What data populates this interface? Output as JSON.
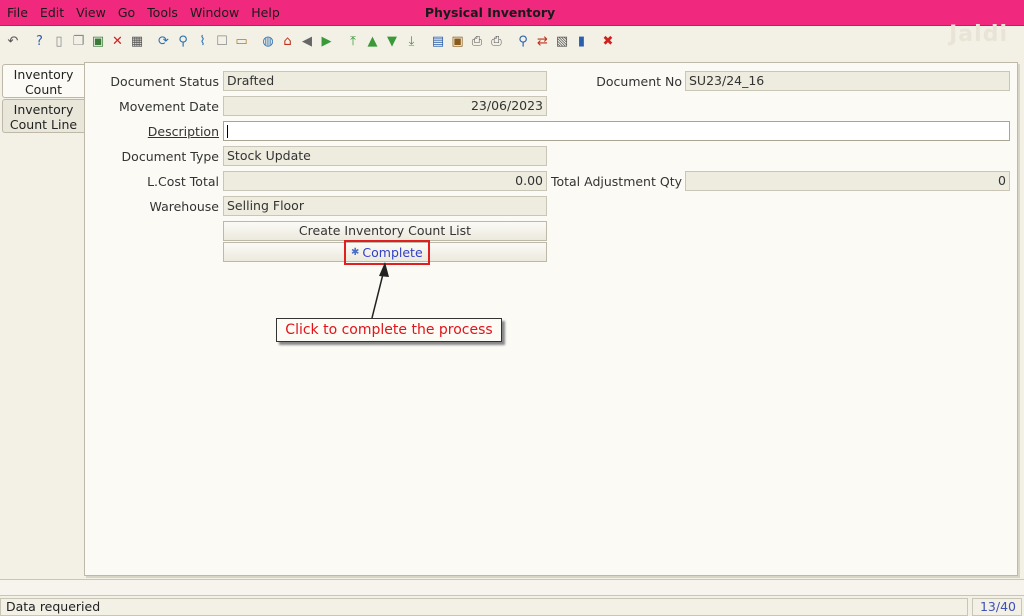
{
  "window": {
    "title": "Physical Inventory"
  },
  "menu": [
    "File",
    "Edit",
    "View",
    "Go",
    "Tools",
    "Window",
    "Help"
  ],
  "logo": "Jaldi",
  "toolbar_icons": [
    {
      "name": "undo-icon",
      "glyph": "↶",
      "color": "#555555"
    },
    {
      "name": "help-icon",
      "glyph": "?",
      "color": "#2a5fb0"
    },
    {
      "name": "new-record-icon",
      "glyph": "▯",
      "color": "#8a8a8a"
    },
    {
      "name": "copy-record-icon",
      "glyph": "❐",
      "color": "#8a8a8a"
    },
    {
      "name": "save-icon",
      "glyph": "▣",
      "color": "#3a7a3a"
    },
    {
      "name": "delete-icon",
      "glyph": "✕",
      "color": "#d02020"
    },
    {
      "name": "grid-toggle-icon",
      "glyph": "▦",
      "color": "#555555"
    },
    {
      "name": "refresh-icon",
      "glyph": "⟳",
      "color": "#2a6fb0"
    },
    {
      "name": "find-icon",
      "glyph": "⚲",
      "color": "#2a6fb0"
    },
    {
      "name": "attachment-icon",
      "glyph": "⌇",
      "color": "#2a6fb0"
    },
    {
      "name": "chat-icon",
      "glyph": "☐",
      "color": "#8a8a8a"
    },
    {
      "name": "history-icon",
      "glyph": "▭",
      "color": "#b07a2a"
    },
    {
      "name": "menu-icon",
      "glyph": "◍",
      "color": "#2a6fb0"
    },
    {
      "name": "home-icon",
      "glyph": "⌂",
      "color": "#c0301c"
    },
    {
      "name": "back-icon",
      "glyph": "◀",
      "color": "#666666"
    },
    {
      "name": "forward-icon",
      "glyph": "▶",
      "color": "#3a9a3a"
    },
    {
      "name": "first-record-icon",
      "glyph": "⤒",
      "color": "#3a9a3a"
    },
    {
      "name": "previous-record-icon",
      "glyph": "▲",
      "color": "#3a9a3a"
    },
    {
      "name": "next-record-icon",
      "glyph": "▼",
      "color": "#3a9a3a"
    },
    {
      "name": "last-record-icon",
      "glyph": "⤓",
      "color": "#3a9a3a"
    },
    {
      "name": "report-icon",
      "glyph": "▤",
      "color": "#2a5fb0"
    },
    {
      "name": "archive-icon",
      "glyph": "▣",
      "color": "#8a5a1a"
    },
    {
      "name": "print-preview-icon",
      "glyph": "⎙",
      "color": "#555555"
    },
    {
      "name": "print-icon",
      "glyph": "⎙",
      "color": "#555555"
    },
    {
      "name": "zoom-across-icon",
      "glyph": "⚲",
      "color": "#2a5fb0"
    },
    {
      "name": "workflow-icon",
      "glyph": "⇄",
      "color": "#c0301c"
    },
    {
      "name": "product-info-icon",
      "glyph": "▧",
      "color": "#555555"
    },
    {
      "name": "request-icon",
      "glyph": "▮",
      "color": "#2a5fb0"
    },
    {
      "name": "close-window-icon",
      "glyph": "✖",
      "color": "#d02020"
    }
  ],
  "tabs": [
    {
      "label": "Inventory Count"
    },
    {
      "label": "Inventory Count Line"
    }
  ],
  "form": {
    "document_status": {
      "label": "Document Status",
      "value": "Drafted"
    },
    "document_no": {
      "label": "Document No",
      "value": "SU23/24_16"
    },
    "movement_date": {
      "label": "Movement Date",
      "value": "23/06/2023"
    },
    "description": {
      "label": "Description",
      "value": ""
    },
    "document_type": {
      "label": "Document Type",
      "value": "Stock Update"
    },
    "lcost_total": {
      "label": "L.Cost Total",
      "value": "0.00"
    },
    "total_adjustment_qty": {
      "label": "Total Adjustment Qty",
      "value": "0"
    },
    "warehouse": {
      "label": "Warehouse",
      "value": "Selling Floor"
    },
    "create_list_button": "Create Inventory Count List",
    "complete_button": "Complete"
  },
  "callout": "Click to complete the process",
  "status": {
    "message": "Data requeried",
    "record_count": "13/40"
  },
  "colors": {
    "menubar": "#f0287e",
    "highlight": "#e02020",
    "link": "#3140c8"
  }
}
